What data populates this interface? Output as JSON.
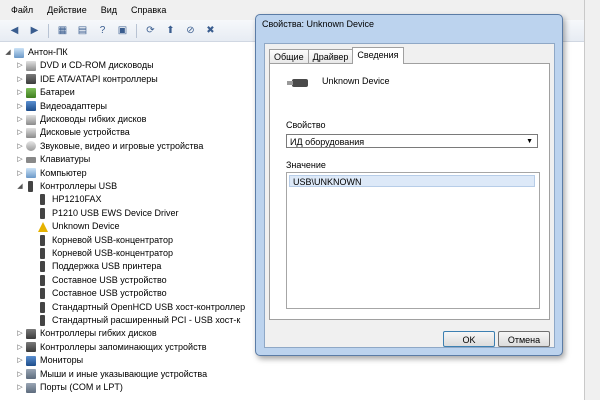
{
  "menu": [
    "Файл",
    "Действие",
    "Вид",
    "Справка"
  ],
  "tree": {
    "root": "Антон-ПК",
    "categories_top": [
      {
        "label": "DVD и CD-ROM дисководы",
        "icon": "disk"
      },
      {
        "label": "IDE ATA/ATAPI контроллеры",
        "icon": "ctl"
      },
      {
        "label": "Батареи",
        "icon": "bat"
      },
      {
        "label": "Видеоадаптеры",
        "icon": "mon"
      },
      {
        "label": "Дисководы гибких дисков",
        "icon": "disk"
      },
      {
        "label": "Дисковые устройства",
        "icon": "disk"
      },
      {
        "label": "Звуковые, видео и игровые устройства",
        "icon": "snd"
      },
      {
        "label": "Клавиатуры",
        "icon": "kb"
      },
      {
        "label": "Компьютер",
        "icon": "pc"
      },
      {
        "label": "Контроллеры USB",
        "icon": "usb"
      }
    ],
    "usb_children": [
      {
        "label": "HP1210FAX",
        "icon": "usb"
      },
      {
        "label": "P1210 USB EWS Device Driver",
        "icon": "usb"
      },
      {
        "label": "Unknown Device",
        "icon": "warn"
      },
      {
        "label": "Корневой USB-концентратор",
        "icon": "usb"
      },
      {
        "label": "Корневой USB-концентратор",
        "icon": "usb"
      },
      {
        "label": "Поддержка USB принтера",
        "icon": "usb"
      },
      {
        "label": "Составное USB устройство",
        "icon": "usb"
      },
      {
        "label": "Составное USB устройство",
        "icon": "usb"
      },
      {
        "label": "Стандартный OpenHCD USB хост-контроллер",
        "icon": "usb"
      },
      {
        "label": "Стандартный расширенный PCI - USB хост-к",
        "icon": "usb"
      }
    ],
    "categories_bottom": [
      {
        "label": "Контроллеры гибких дисков",
        "icon": "ctl"
      },
      {
        "label": "Контроллеры запоминающих устройств",
        "icon": "ctl"
      },
      {
        "label": "Мониторы",
        "icon": "mon"
      },
      {
        "label": "Мыши и иные указывающие устройства",
        "icon": "dev"
      },
      {
        "label": "Порты (COM и LPT)",
        "icon": "dev"
      }
    ]
  },
  "dialog": {
    "title": "Свойства: Unknown Device",
    "tabs": [
      "Общие",
      "Драйвер",
      "Сведения"
    ],
    "active_tab": 2,
    "device_name": "Unknown Device",
    "property_label": "Свойство",
    "property_value": "ИД оборудования",
    "value_label": "Значение",
    "value_item": "USB\\UNKNOWN",
    "ok_label": "OK",
    "cancel_label": "Отмена"
  }
}
